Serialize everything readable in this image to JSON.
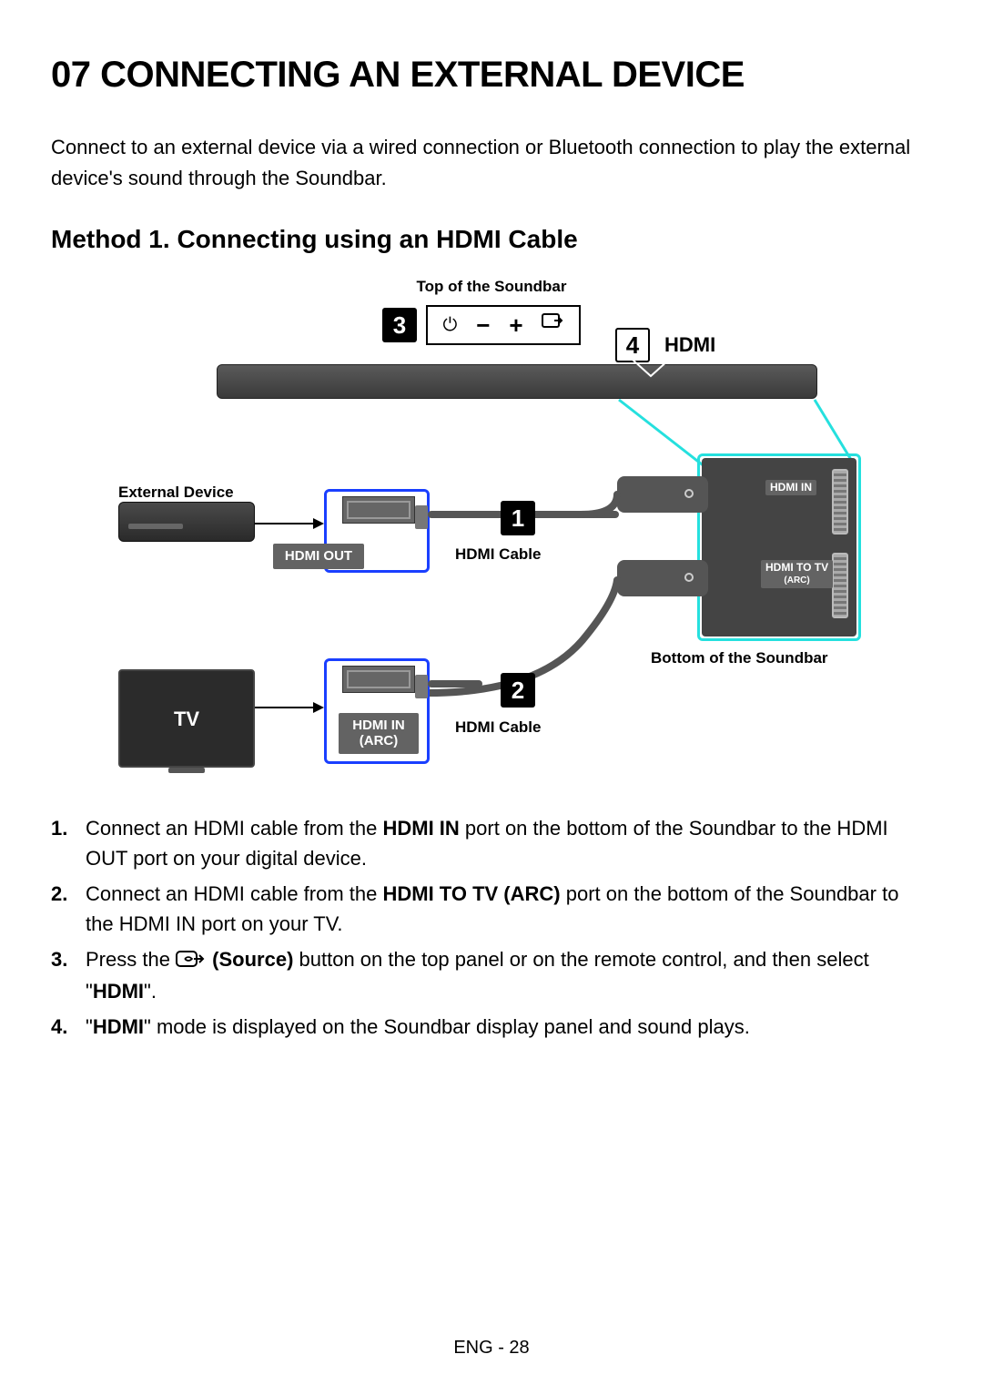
{
  "page": {
    "section_number": "07",
    "title_prefix": "07   ",
    "title": "CONNECTING AN EXTERNAL DEVICE",
    "intro": "Connect to an external device via a wired connection or Bluetooth connection to play the external device's sound through the Soundbar.",
    "method_heading": "Method 1. Connecting using an HDMI Cable",
    "footer": "ENG - 28"
  },
  "diagram": {
    "top_panel_label": "Top of the Soundbar",
    "hdmi_mode": "HDMI",
    "external_device": "External Device",
    "hdmi_out": "HDMI OUT",
    "hdmi_cable": "HDMI Cable",
    "hdmi_in": "HDMI IN",
    "hdmi_to_tv": "HDMI TO TV",
    "arc": "(ARC)",
    "hdmi_in_arc_l1": "HDMI IN",
    "hdmi_in_arc_l2": "(ARC)",
    "bottom_label": "Bottom of the Soundbar",
    "tv": "TV",
    "badges": {
      "b1": "1",
      "b2": "2",
      "b3": "3",
      "b4": "4"
    }
  },
  "steps": {
    "s1_a": "Connect an HDMI cable from the ",
    "s1_b": "HDMI IN",
    "s1_c": " port on the bottom of the Soundbar to the HDMI OUT port on your digital device.",
    "s2_a": "Connect an HDMI cable from the ",
    "s2_b": "HDMI TO TV (ARC)",
    "s2_c": " port on the bottom of the Soundbar to the HDMI IN port on your TV.",
    "s3_a": "Press the ",
    "s3_b": " (Source)",
    "s3_c": " button on the top panel or on the remote control, and then select \"",
    "s3_d": "HDMI",
    "s3_e": "\".",
    "s4_a": "\"",
    "s4_b": "HDMI",
    "s4_c": "\" mode is displayed on the Soundbar display panel and sound plays."
  }
}
